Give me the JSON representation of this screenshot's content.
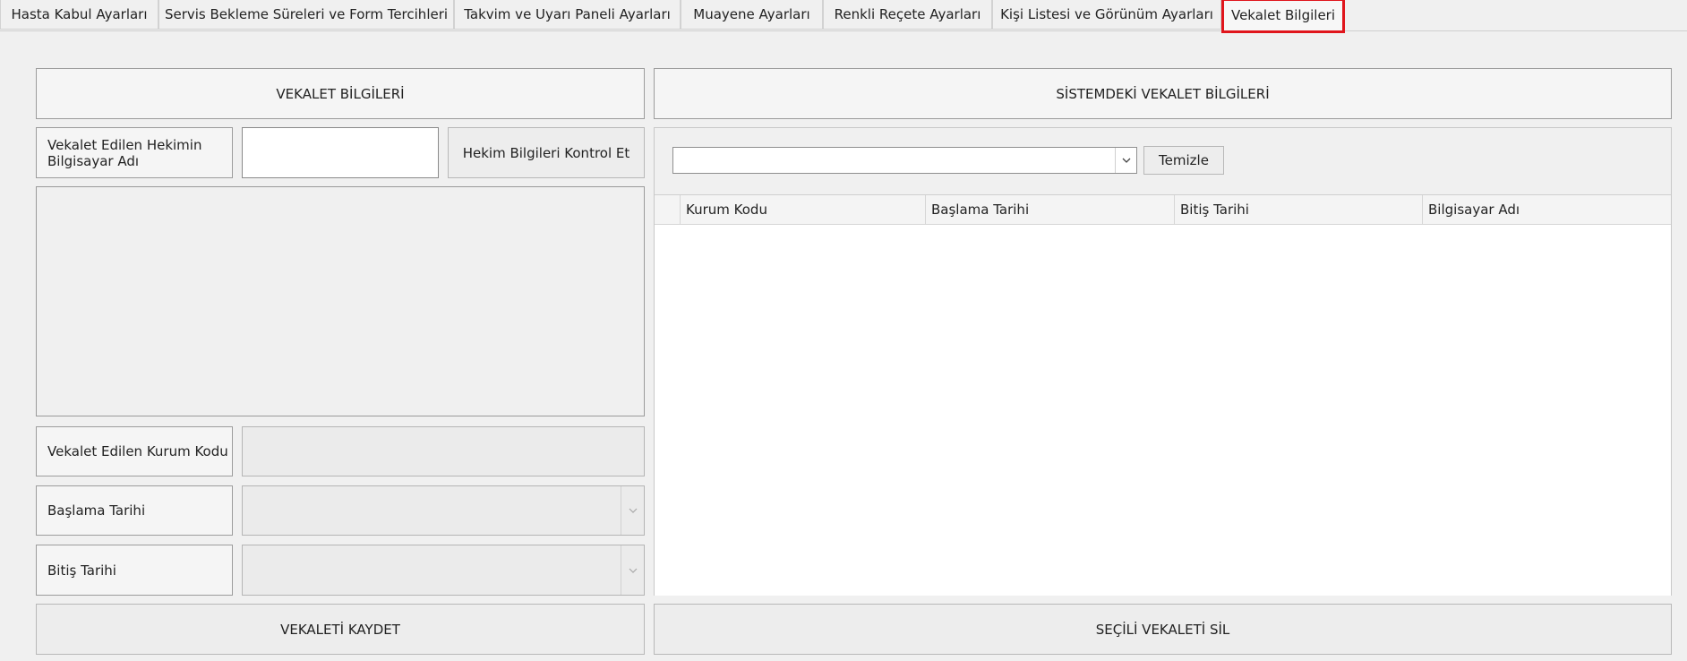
{
  "tabs": [
    {
      "label": "Hasta Kabul Ayarları"
    },
    {
      "label": "Servis Bekleme Süreleri ve Form Tercihleri"
    },
    {
      "label": "Takvim ve Uyarı Paneli Ayarları"
    },
    {
      "label": "Muayene Ayarları"
    },
    {
      "label": "Renkli Reçete Ayarları"
    },
    {
      "label": "Kişi Listesi ve Görünüm Ayarları"
    },
    {
      "label": "Vekalet Bilgileri"
    }
  ],
  "left": {
    "header": "VEKALET BİLGİLERİ",
    "computer_name_label": "Vekalet Edilen Hekimin Bilgisayar Adı",
    "computer_name_value": "",
    "check_button": "Hekim Bilgileri Kontrol Et",
    "institution_code_label": "Vekalet Edilen Kurum Kodu",
    "start_date_label": "Başlama Tarihi",
    "end_date_label": "Bitiş Tarihi",
    "save_button": "VEKALETİ KAYDET"
  },
  "right": {
    "header": "SİSTEMDEKİ VEKALET BİLGİLERİ",
    "filter_value": "",
    "clear_button": "Temizle",
    "columns": [
      "Kurum Kodu",
      "Başlama Tarihi",
      "Bitiş Tarihi",
      "Bilgisayar Adı"
    ],
    "rows": [],
    "delete_button": "SEÇİLİ VEKALETİ SİL"
  },
  "icons": {
    "dropdown": "chevron-down-icon"
  }
}
